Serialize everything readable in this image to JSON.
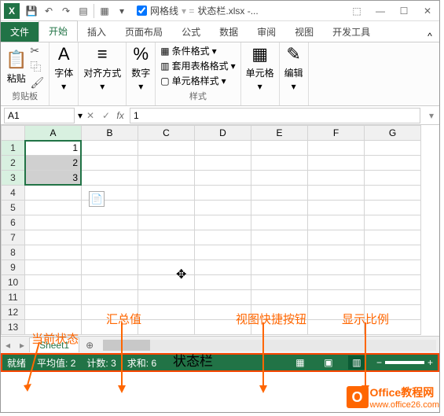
{
  "qat": {
    "gridlines_label": "网格线",
    "title": "状态栏.xlsx -..."
  },
  "tabs": {
    "file": "文件",
    "home": "开始",
    "insert": "插入",
    "layout": "页面布局",
    "formulas": "公式",
    "data": "数据",
    "review": "审阅",
    "view": "视图",
    "dev": "开发工具"
  },
  "ribbon": {
    "clipboard": {
      "paste": "粘贴",
      "label": "剪贴板"
    },
    "font": {
      "label": "字体"
    },
    "align": {
      "label": "对齐方式"
    },
    "number": {
      "label": "数字"
    },
    "styles": {
      "cond": "条件格式",
      "table": "套用表格格式",
      "cell": "单元格样式",
      "label": "样式"
    },
    "cells": {
      "label": "单元格"
    },
    "editing": {
      "label": "编辑"
    }
  },
  "namebox": {
    "ref": "A1",
    "formula": "1"
  },
  "cols": [
    "A",
    "B",
    "C",
    "D",
    "E",
    "F",
    "G"
  ],
  "rows": [
    "1",
    "2",
    "3",
    "4",
    "5",
    "6",
    "7",
    "8",
    "9",
    "10",
    "11",
    "12",
    "13"
  ],
  "cells": {
    "A1": "1",
    "A2": "2",
    "A3": "3"
  },
  "sheet": {
    "name": "Sheet1"
  },
  "status": {
    "ready": "就绪",
    "avg_l": "平均值:",
    "avg_v": "2",
    "cnt_l": "计数:",
    "cnt_v": "3",
    "sum_l": "求和:",
    "sum_v": "6"
  },
  "anno": {
    "state": "当前状态",
    "summary": "汇总值",
    "bar": "状态栏",
    "viewbtn": "视图快捷按钮",
    "zoom": "显示比例"
  },
  "wm": {
    "name": "Office教程网",
    "url": "www.office26.com"
  }
}
